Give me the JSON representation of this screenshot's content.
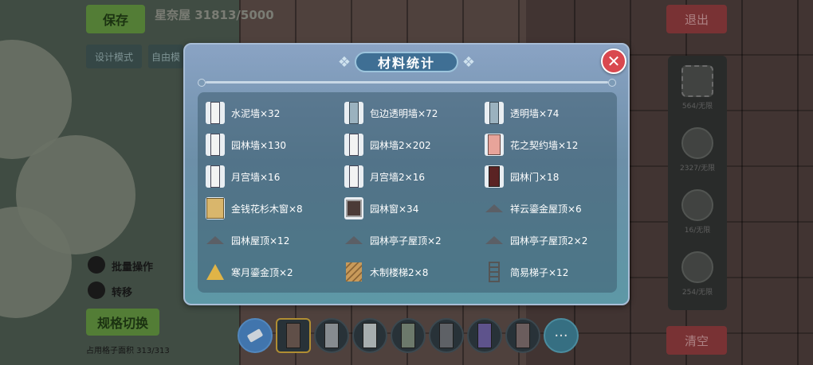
{
  "background": {
    "save_label": "保存",
    "house_title": "星奈屋 31813/5000",
    "design_mode_label": "设计模式",
    "free_label": "自由模",
    "exit_label": "退出",
    "clear_label": "清空",
    "batch_label": "批量操作",
    "rotate_label": "转移",
    "spec_switch_label": "规格切换",
    "layout_count": "占用格子面积 313/313",
    "side_items": [
      {
        "count": "564/无限"
      },
      {
        "count": "2327/无限"
      },
      {
        "count": "16/无限"
      },
      {
        "count": "254/无限"
      }
    ],
    "toolbar_more": "···"
  },
  "modal": {
    "title": "材料统计",
    "close_icon": "close-icon",
    "items": [
      {
        "name": "水泥墙×32",
        "icon": "wall"
      },
      {
        "name": "包边透明墙×72",
        "icon": "glass"
      },
      {
        "name": "透明墙×74",
        "icon": "glass"
      },
      {
        "name": "园林墙×130",
        "icon": "wall"
      },
      {
        "name": "园林墙2×202",
        "icon": "wall"
      },
      {
        "name": "花之契约墙×12",
        "icon": "pink"
      },
      {
        "name": "月宫墙×16",
        "icon": "wall"
      },
      {
        "name": "月宫墙2×16",
        "icon": "wall"
      },
      {
        "name": "园林门×18",
        "icon": "door"
      },
      {
        "name": "金钱花杉木窗×8",
        "icon": "window"
      },
      {
        "name": "园林窗×34",
        "icon": "win2"
      },
      {
        "name": "祥云鎏金屋顶×6",
        "icon": "roof"
      },
      {
        "name": "园林屋顶×12",
        "icon": "roof"
      },
      {
        "name": "园林亭子屋顶×2",
        "icon": "roof"
      },
      {
        "name": "园林亭子屋顶2×2",
        "icon": "roof"
      },
      {
        "name": "寒月鎏金顶×2",
        "icon": "gold"
      },
      {
        "name": "木制楼梯2×8",
        "icon": "stairs"
      },
      {
        "name": "简易梯子×12",
        "icon": "ladder"
      }
    ]
  },
  "colors": {
    "accent_red": "#d9484f",
    "title_plate": "#3f6f94",
    "save_green": "#5f8f3e"
  }
}
